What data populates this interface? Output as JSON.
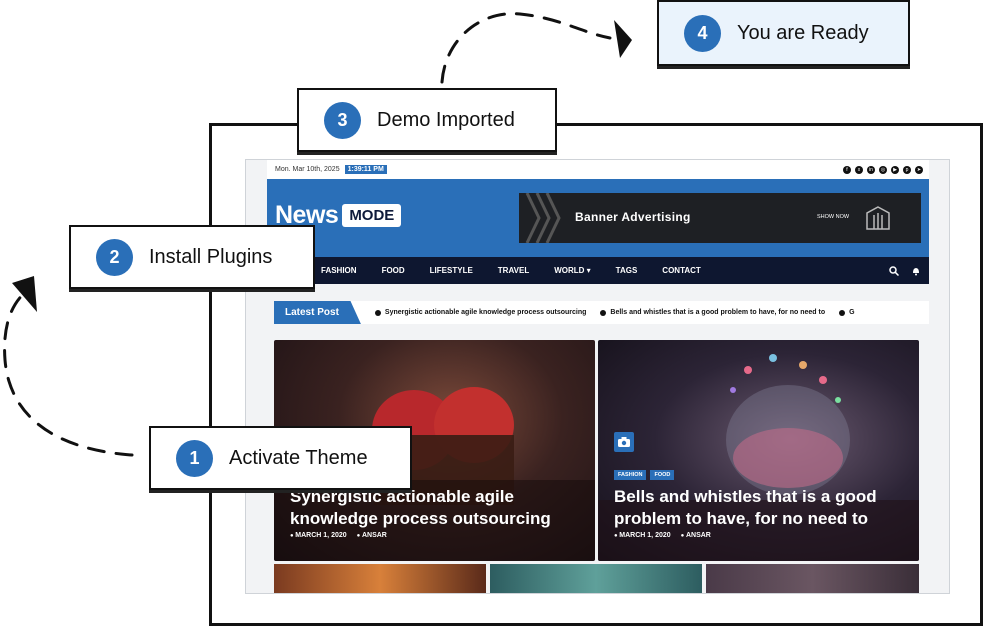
{
  "steps": [
    {
      "num": "1",
      "label": "Activate Theme"
    },
    {
      "num": "2",
      "label": "Install Plugins"
    },
    {
      "num": "3",
      "label": "Demo Imported"
    },
    {
      "num": "4",
      "label": "You are Ready"
    }
  ],
  "site": {
    "date": "Mon. Mar 10th, 2025",
    "time": "1:39:11 PM",
    "logo_news": "News",
    "logo_mode": "MODE",
    "banner_title": "Banner Advertising",
    "banner_show": "SHOW NOW",
    "nav": [
      "FASHION",
      "FOOD",
      "LIFESTYLE",
      "TRAVEL",
      "WORLD ▾",
      "TAGS",
      "CONTACT"
    ],
    "ticker_label": "Latest Post",
    "ticker": [
      "Synergistic actionable agile knowledge process outsourcing",
      "Bells and whistles that is a good problem to have, for no need to",
      "G"
    ],
    "cards": [
      {
        "headline": "Synergistic actionable agile knowledge process outsourcing",
        "date": "MARCH 1, 2020",
        "author": "ANSAR"
      },
      {
        "headline": "Bells and whistles that is a good problem to have, for no need to",
        "date": "MARCH 1, 2020",
        "author": "ANSAR",
        "tags": [
          "FASHION",
          "FOOD"
        ]
      }
    ]
  },
  "colors": {
    "accent": "#2a6fb8",
    "nav": "#0e1730",
    "ready_bg": "#eaf3fc"
  }
}
